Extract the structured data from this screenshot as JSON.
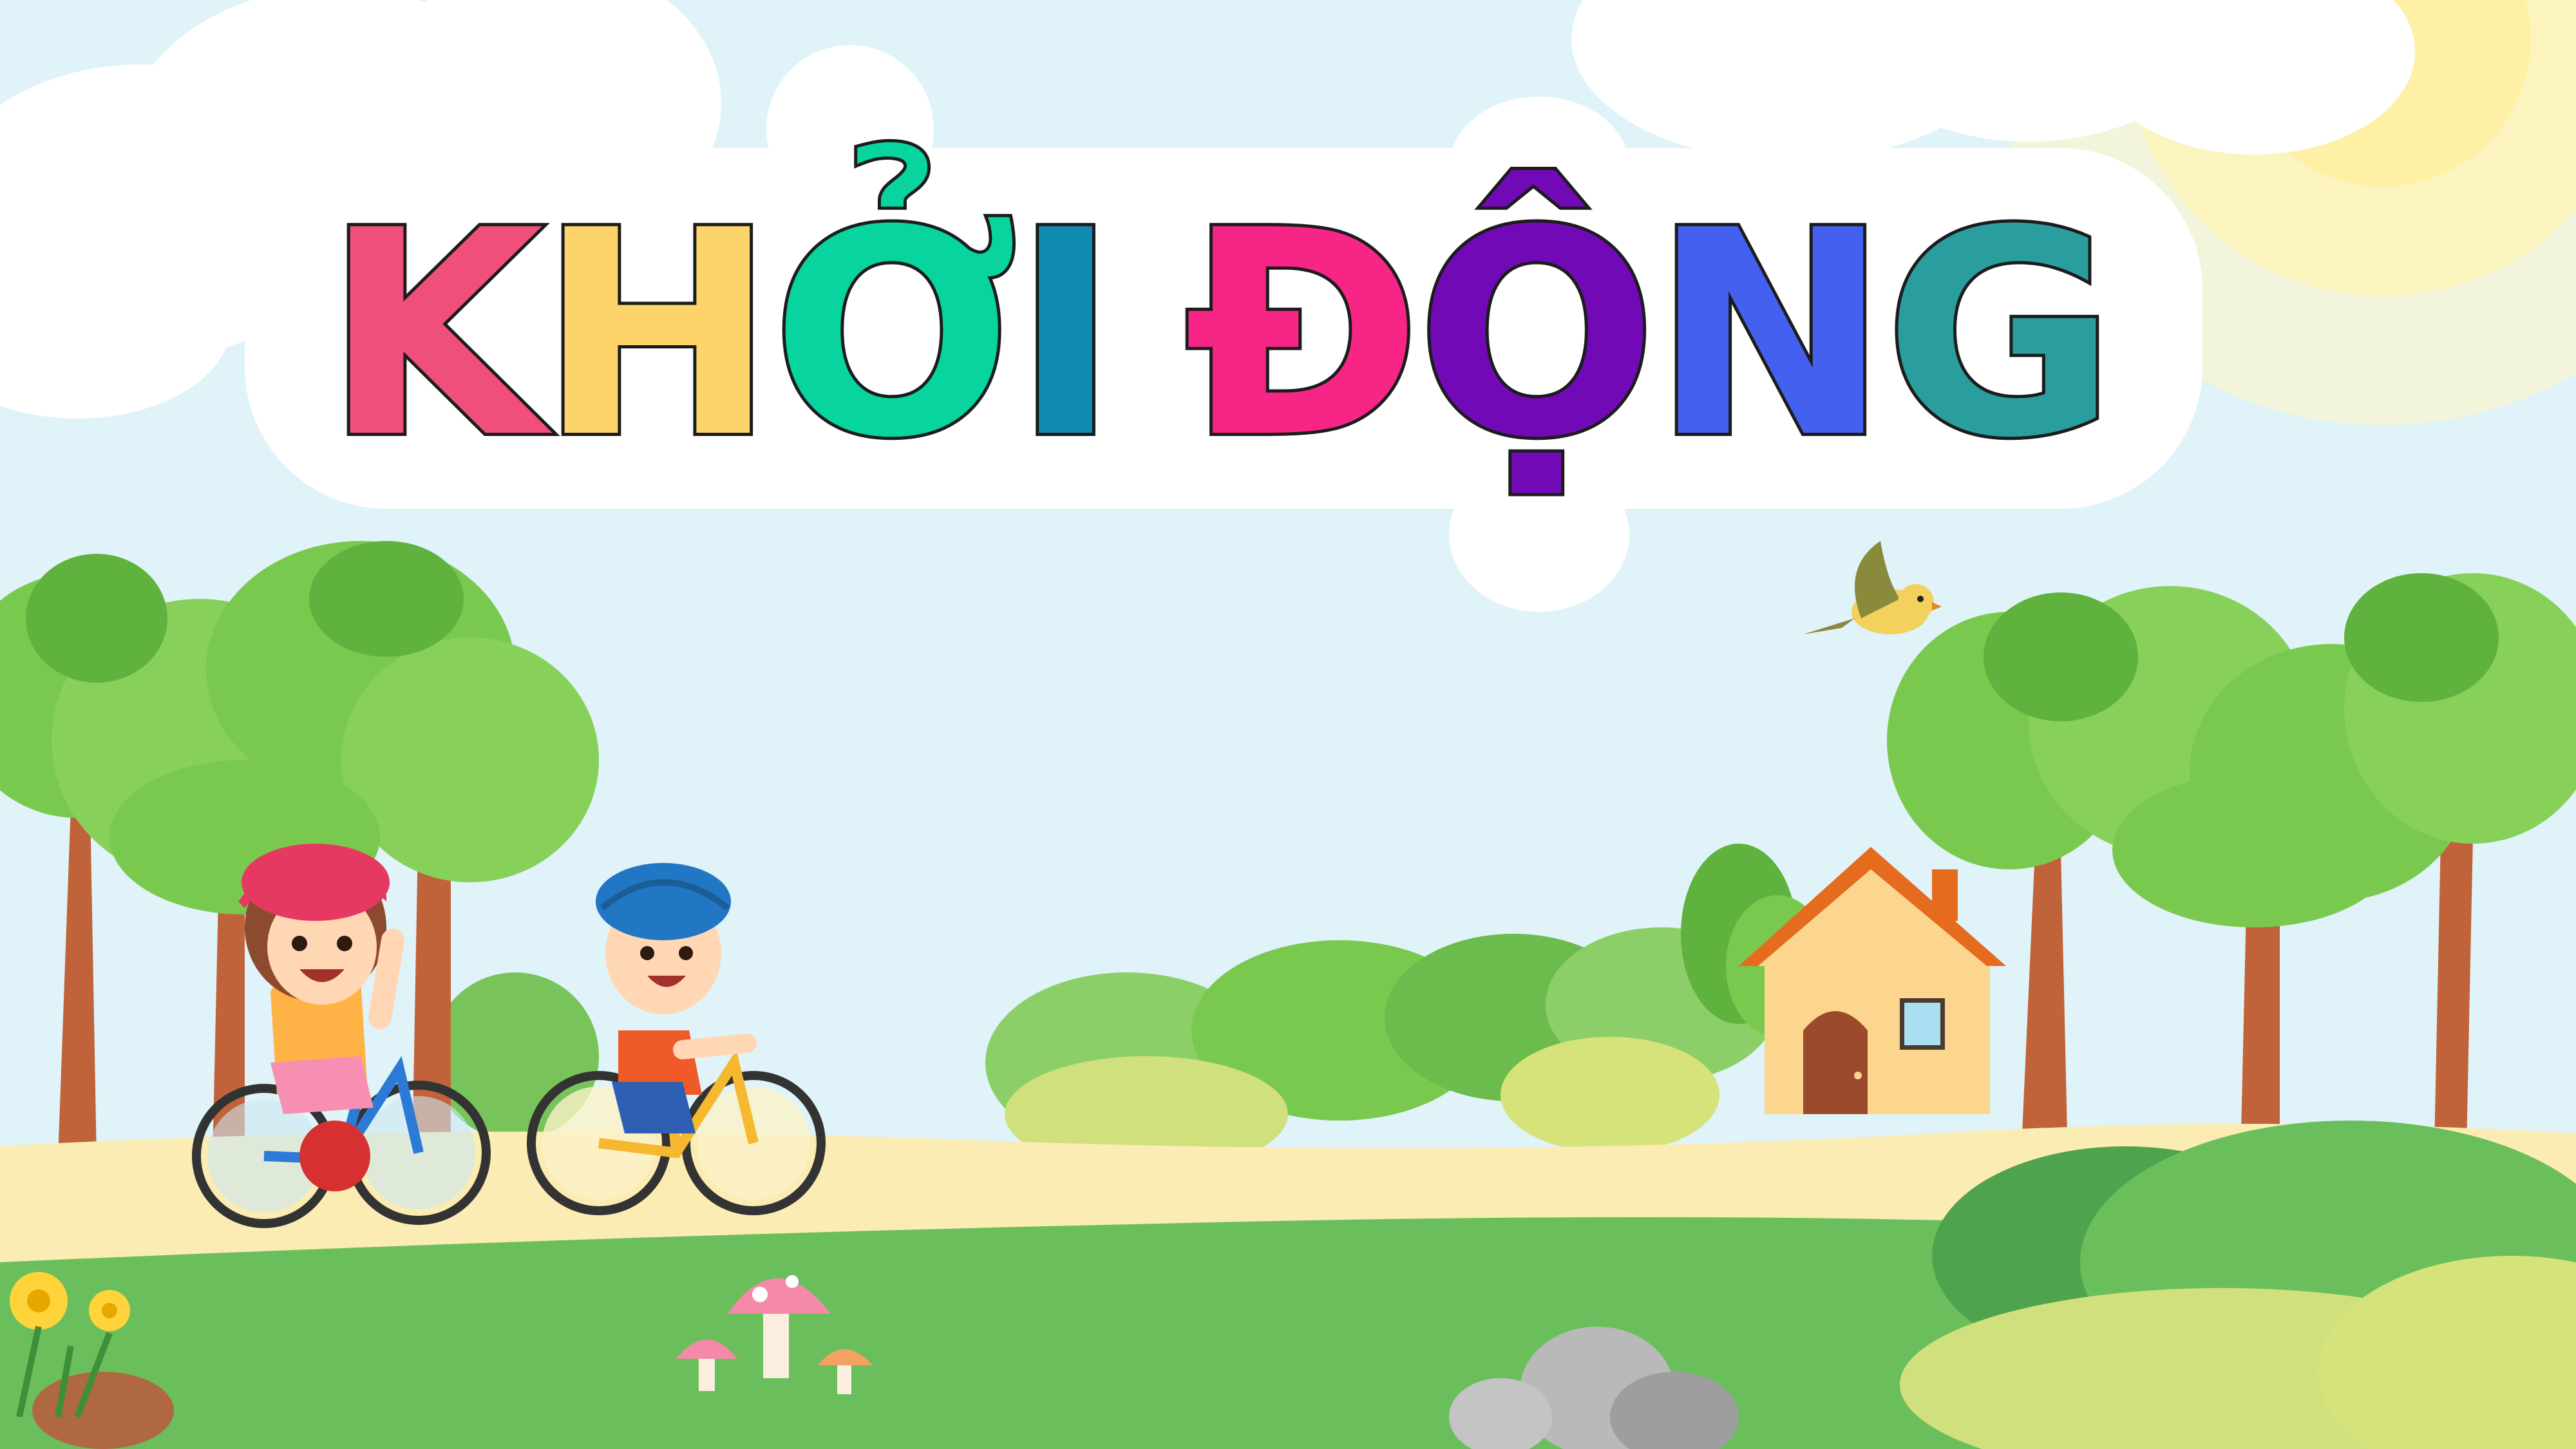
{
  "title": {
    "text": "KHỞI ĐỘNG",
    "letters": [
      {
        "char": "K",
        "color": "#ef4f7a"
      },
      {
        "char": "H",
        "color": "#fdd46a"
      },
      {
        "char": "Ở",
        "color": "#07d49f"
      },
      {
        "char": "I",
        "color": "#118ab2"
      },
      {
        "char": "Đ",
        "color": "#f72585"
      },
      {
        "char": "Ộ",
        "color": "#7209b7"
      },
      {
        "char": "N",
        "color": "#4361ee"
      },
      {
        "char": "G",
        "color": "#2a9d9f"
      }
    ]
  },
  "colors": {
    "sky": "#dff3f8",
    "cloud": "#ffffff",
    "sun": "#fff1a8",
    "tree_leaf": "#7ac94f",
    "tree_leaf_dark": "#5fb23e",
    "tree_trunk": "#c0633a",
    "path": "#fbecb3",
    "grass": "#6abf5c",
    "grass_dark": "#4fa34e",
    "house_wall": "#fcd68f",
    "house_roof": "#e56b1f",
    "house_door": "#9b4a2c"
  },
  "icons": [
    "cloud-icon",
    "sun-icon",
    "bird-icon",
    "tree-icon",
    "house-icon",
    "girl-cyclist-icon",
    "boy-cyclist-icon",
    "mushroom-icon",
    "flower-icon",
    "rock-icon"
  ]
}
